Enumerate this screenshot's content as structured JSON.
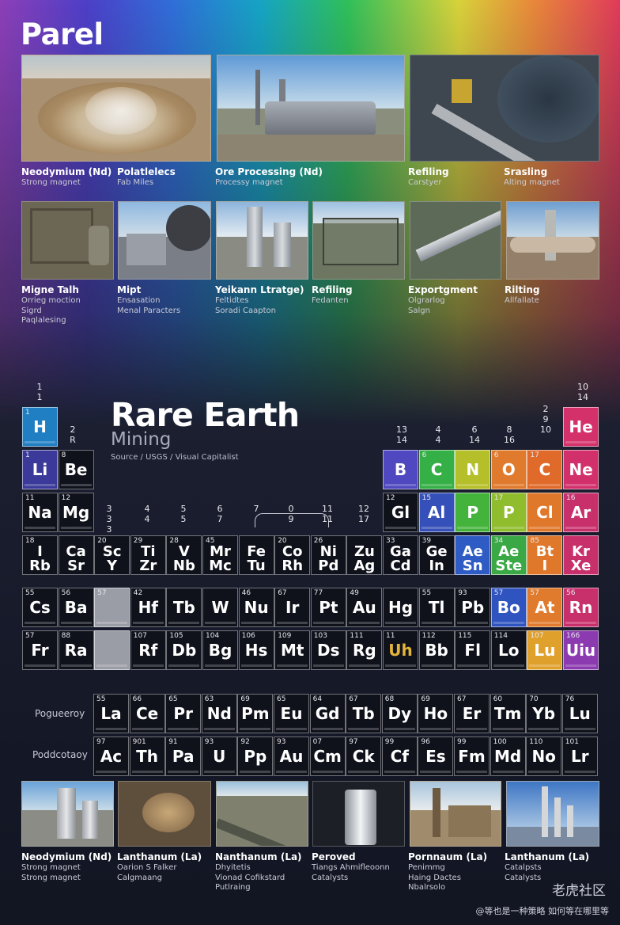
{
  "header": {
    "title": "Parel"
  },
  "top_row": [
    {
      "title": "Neodymium (Nd)",
      "sub": [
        "Strong magnet"
      ]
    },
    {
      "title": "Polatlelecs",
      "sub": [
        "Fab Miles"
      ]
    },
    {
      "title": "Ore Processing (Nd)",
      "sub": [
        "Processy magnet"
      ]
    },
    {
      "title": "Refiling",
      "sub": [
        "Carstyer"
      ]
    },
    {
      "title": "Srasling",
      "sub": [
        "Alting magnet"
      ]
    }
  ],
  "mid_row": [
    {
      "title": "Migne Talh",
      "sub": [
        "Orrieg moction",
        "Sigrd",
        "Paqlalesing"
      ]
    },
    {
      "title": "Mipt",
      "sub": [
        "Ensasation",
        "Menal Paracters"
      ]
    },
    {
      "title": "Yeikann Ltratge)",
      "sub": [
        "Feltidtes",
        "Soradi Caapton"
      ]
    },
    {
      "title": "Refiling",
      "sub": [
        "Fedanten"
      ]
    },
    {
      "title": "Exportgment",
      "sub": [
        "Olgrarlog",
        "Salgn"
      ]
    },
    {
      "title": "Rilting",
      "sub": [
        "Allfallate"
      ]
    }
  ],
  "bottom_row": [
    {
      "title": "Neodymium (Nd)",
      "sub": [
        "Strong magnet",
        "Strong magnet"
      ]
    },
    {
      "title": "Lanthanum (La)",
      "sub": [
        "Oarion S Falker",
        "Calgmaang"
      ]
    },
    {
      "title": "Nanthanum (La)",
      "sub": [
        "Dhyitetis",
        "Vionad Cofikstard",
        "Putlraing"
      ]
    },
    {
      "title": "Peroved",
      "sub": [
        "Tiangs Ahmifleoonn",
        "Catalysts"
      ]
    },
    {
      "title": "Pornnaum (La)",
      "sub": [
        "Penimmg",
        "Haing Dactes",
        "Nbalrsolo"
      ]
    },
    {
      "title": "Lanthanum (La)",
      "sub": [
        "Catalpsts",
        "Catalysts"
      ]
    }
  ],
  "table": {
    "title": "Rare Earth",
    "subtitle": "Mining",
    "source": "Source / USGS / Visual Capitalist",
    "series_labels": [
      "Pogueeroy",
      "Poddcotaoy"
    ],
    "group_numbers": [
      {
        "t": "1\n1"
      },
      {
        "t": "2\nR"
      },
      {
        "t": "3\n3\n3"
      },
      {
        "t": "4\n4"
      },
      {
        "t": "5\n5"
      },
      {
        "t": "6\n7"
      },
      {
        "t": "7"
      },
      {
        "t": "0\n9"
      },
      {
        "t": "11\n11"
      },
      {
        "t": "12\n17"
      },
      {
        "t": "13\n14"
      },
      {
        "t": "4\n4"
      },
      {
        "t": "6\n14"
      },
      {
        "t": "8\n16"
      },
      {
        "t": "2\n9\n10"
      },
      {
        "t": "10\n14"
      }
    ],
    "cells": [
      {
        "n": "1",
        "s": "H",
        "c": "#1f7fc2",
        "col": 0,
        "row": 0
      },
      {
        "n": "",
        "s": "He",
        "c": "#d4306a",
        "col": 17,
        "row": 0
      },
      {
        "n": "1",
        "s": "Li",
        "c": "#3b3a9a",
        "col": 0,
        "row": 1
      },
      {
        "n": "8",
        "s": "Be",
        "c": "",
        "col": 1,
        "row": 1
      },
      {
        "n": "",
        "s": "B",
        "c": "#5048c0",
        "col": 12,
        "row": 1
      },
      {
        "n": "6",
        "s": "C",
        "c": "#35b046",
        "col": 13,
        "row": 1
      },
      {
        "n": "",
        "s": "N",
        "c": "#b5bf2a",
        "col": 14,
        "row": 1
      },
      {
        "n": "6",
        "s": "O",
        "c": "#e07a2c",
        "col": 15,
        "row": 1
      },
      {
        "n": "17",
        "s": "C",
        "c": "#e06a2a",
        "col": 16,
        "row": 1
      },
      {
        "n": "",
        "s": "Ne",
        "c": "#d2306a",
        "col": 17,
        "row": 1
      },
      {
        "n": "11",
        "s": "Na",
        "c": "",
        "col": 0,
        "row": 2
      },
      {
        "n": "12",
        "s": "Mg",
        "c": "",
        "col": 1,
        "row": 2
      },
      {
        "n": "12",
        "s": "Gl",
        "c": "",
        "col": 12,
        "row": 2
      },
      {
        "n": "15",
        "s": "Al",
        "c": "#3550b8",
        "col": 13,
        "row": 2
      },
      {
        "n": "",
        "s": "P",
        "c": "#44b33c",
        "col": 14,
        "row": 2
      },
      {
        "n": "17",
        "s": "P",
        "c": "#8fbd2e",
        "col": 15,
        "row": 2
      },
      {
        "n": "",
        "s": "Cl",
        "c": "#e0782c",
        "col": 16,
        "row": 2
      },
      {
        "n": "16",
        "s": "Ar",
        "c": "#c8306c",
        "col": 17,
        "row": 2
      },
      {
        "n": "18",
        "s": "I\nRb",
        "c": "",
        "col": 0,
        "row": 3
      },
      {
        "n": "",
        "s": "Ca\nSr",
        "c": "",
        "col": 1,
        "row": 3
      },
      {
        "n": "20",
        "s": "Sc\nY",
        "c": "",
        "col": 2,
        "row": 3
      },
      {
        "n": "29",
        "s": "Ti\nZr",
        "c": "",
        "col": 3,
        "row": 3
      },
      {
        "n": "28",
        "s": "V\nNb",
        "c": "",
        "col": 4,
        "row": 3
      },
      {
        "n": "45",
        "s": "Mr\nMc",
        "c": "",
        "col": 5,
        "row": 3
      },
      {
        "n": "",
        "s": "Fe\nTu",
        "c": "",
        "col": 6,
        "row": 3
      },
      {
        "n": "20",
        "s": "Co\nRh",
        "c": "",
        "col": 7,
        "row": 3
      },
      {
        "n": "26",
        "s": "Ni\nPd",
        "c": "",
        "col": 8,
        "row": 3
      },
      {
        "n": "",
        "s": "Zu\nAg",
        "c": "",
        "col": 9,
        "row": 3
      },
      {
        "n": "33",
        "s": "Ga\nCd",
        "c": "",
        "col": 10,
        "row": 3
      },
      {
        "n": "39",
        "s": "Ge\nIn",
        "c": "",
        "col": 11,
        "row": 3
      },
      {
        "n": "",
        "s": "Ae\nSn",
        "c": "#2f5cc4",
        "col": 12,
        "row": 3
      },
      {
        "n": "34",
        "s": "Ae\nSte",
        "c": "#3aa844",
        "col": 13,
        "row": 3
      },
      {
        "n": "85",
        "s": "Bt\nI",
        "c": "#e0782c",
        "col": 14,
        "row": 3
      },
      {
        "n": "",
        "s": "Kr\nXe",
        "c": "#c8306c",
        "col": 15,
        "row": 3
      },
      {
        "n": "55",
        "s": "Cs",
        "c": "",
        "col": 0,
        "row": 4
      },
      {
        "n": "56",
        "s": "Ba",
        "c": "",
        "col": 1,
        "row": 4
      },
      {
        "n": "57",
        "s": "",
        "c": "#9a9ca6",
        "col": 2,
        "row": 4
      },
      {
        "n": "42",
        "s": "Hf",
        "c": "",
        "col": 3,
        "row": 4
      },
      {
        "n": "",
        "s": "Tb",
        "c": "",
        "col": 4,
        "row": 4
      },
      {
        "n": "",
        "s": "W",
        "c": "",
        "col": 5,
        "row": 4
      },
      {
        "n": "46",
        "s": "Nu",
        "c": "",
        "col": 6,
        "row": 4
      },
      {
        "n": "67",
        "s": "Ir",
        "c": "",
        "col": 7,
        "row": 4
      },
      {
        "n": "77",
        "s": "Pt",
        "c": "",
        "col": 8,
        "row": 4
      },
      {
        "n": "49",
        "s": "Au",
        "c": "",
        "col": 9,
        "row": 4
      },
      {
        "n": "",
        "s": "Hg",
        "c": "",
        "col": 10,
        "row": 4
      },
      {
        "n": "55",
        "s": "Tl",
        "c": "",
        "col": 11,
        "row": 4
      },
      {
        "n": "93",
        "s": "Pb",
        "c": "",
        "col": 12,
        "row": 4
      },
      {
        "n": "57",
        "s": "Bo",
        "c": "#2f54c0",
        "col": 13,
        "row": 4
      },
      {
        "n": "57",
        "s": "At",
        "c": "#e07a2c",
        "col": 14,
        "row": 4
      },
      {
        "n": "56",
        "s": "Rn",
        "c": "#c8306c",
        "col": 15,
        "row": 4
      },
      {
        "n": "57",
        "s": "Fr",
        "c": "",
        "col": 0,
        "row": 5
      },
      {
        "n": "88",
        "s": "Ra",
        "c": "",
        "col": 1,
        "row": 5
      },
      {
        "n": "",
        "s": "",
        "c": "#9a9ca6",
        "col": 2,
        "row": 5
      },
      {
        "n": "107",
        "s": "Rf",
        "c": "",
        "col": 3,
        "row": 5
      },
      {
        "n": "105",
        "s": "Db",
        "c": "",
        "col": 4,
        "row": 5
      },
      {
        "n": "104",
        "s": "Bg",
        "c": "",
        "col": 5,
        "row": 5
      },
      {
        "n": "106",
        "s": "Hs",
        "c": "",
        "col": 6,
        "row": 5
      },
      {
        "n": "109",
        "s": "Mt",
        "c": "",
        "col": 7,
        "row": 5
      },
      {
        "n": "103",
        "s": "Ds",
        "c": "",
        "col": 8,
        "row": 5
      },
      {
        "n": "111",
        "s": "Rg",
        "c": "",
        "col": 9,
        "row": 5
      },
      {
        "n": "11",
        "s": "Uh",
        "c": "",
        "col": 10,
        "row": 5,
        "gold": true
      },
      {
        "n": "112",
        "s": "Bb",
        "c": "",
        "col": 11,
        "row": 5
      },
      {
        "n": "115",
        "s": "Fl",
        "c": "",
        "col": 12,
        "row": 5
      },
      {
        "n": "114",
        "s": "Lo",
        "c": "",
        "col": 13,
        "row": 5
      },
      {
        "n": "107",
        "s": "Lu",
        "c": "#e0a02c",
        "col": 14,
        "row": 5
      },
      {
        "n": "166",
        "s": "Uiu",
        "c": "#8c3ab0",
        "col": 15,
        "row": 5
      }
    ],
    "lanthanides": [
      {
        "n": "55",
        "s": "La"
      },
      {
        "n": "66",
        "s": "Ce"
      },
      {
        "n": "65",
        "s": "Pr"
      },
      {
        "n": "63",
        "s": "Nd"
      },
      {
        "n": "69",
        "s": "Pm"
      },
      {
        "n": "65",
        "s": "Eu"
      },
      {
        "n": "64",
        "s": "Gd"
      },
      {
        "n": "67",
        "s": "Tb"
      },
      {
        "n": "68",
        "s": "Dy"
      },
      {
        "n": "69",
        "s": "Ho"
      },
      {
        "n": "67",
        "s": "Er"
      },
      {
        "n": "60",
        "s": "Tm"
      },
      {
        "n": "70",
        "s": "Yb"
      },
      {
        "n": "76",
        "s": "Lu"
      }
    ],
    "actinides": [
      {
        "n": "97",
        "s": "Ac"
      },
      {
        "n": "901",
        "s": "Th"
      },
      {
        "n": "91",
        "s": "Pa"
      },
      {
        "n": "93",
        "s": "U"
      },
      {
        "n": "92",
        "s": "Pp"
      },
      {
        "n": "93",
        "s": "Au"
      },
      {
        "n": "07",
        "s": "Cm"
      },
      {
        "n": "97",
        "s": "Ck"
      },
      {
        "n": "99",
        "s": "Cf"
      },
      {
        "n": "96",
        "s": "Es"
      },
      {
        "n": "99",
        "s": "Fm"
      },
      {
        "n": "100",
        "s": "Md"
      },
      {
        "n": "110",
        "s": "No"
      },
      {
        "n": "101",
        "s": "Lr"
      }
    ]
  },
  "watermark": {
    "brand": "老虎社区",
    "user": "@等也是一种策略 如何等在哪里等"
  }
}
